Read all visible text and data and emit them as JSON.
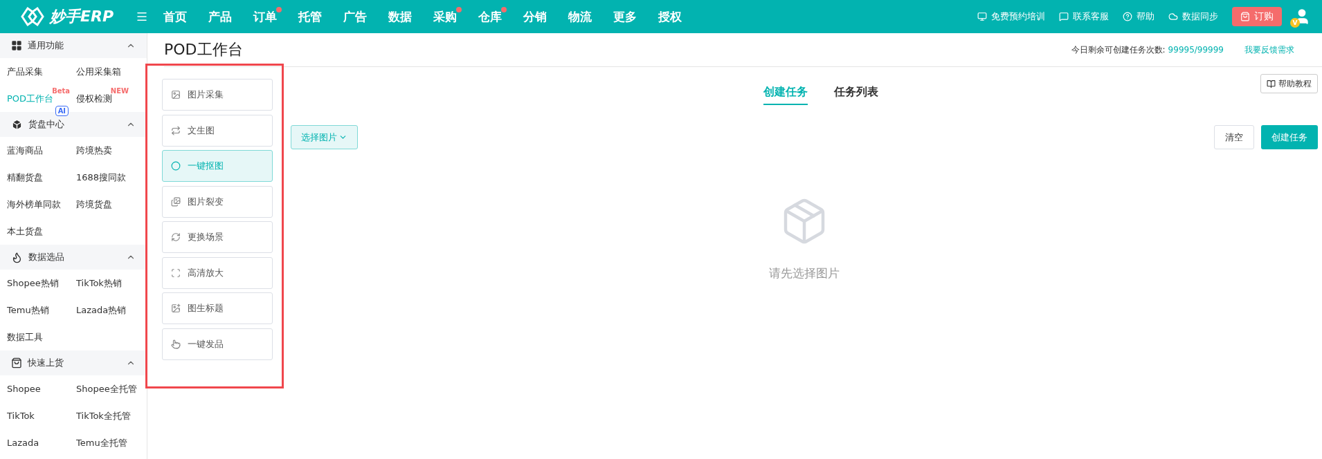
{
  "header": {
    "logo": "妙手ERP",
    "nav": [
      {
        "label": "首页",
        "dot": false
      },
      {
        "label": "产品",
        "dot": false
      },
      {
        "label": "订单",
        "dot": true
      },
      {
        "label": "托管",
        "dot": false
      },
      {
        "label": "广告",
        "dot": false
      },
      {
        "label": "数据",
        "dot": false
      },
      {
        "label": "采购",
        "dot": true
      },
      {
        "label": "仓库",
        "dot": true
      },
      {
        "label": "分销",
        "dot": false
      },
      {
        "label": "物流",
        "dot": false
      },
      {
        "label": "更多",
        "dot": false
      },
      {
        "label": "授权",
        "dot": false
      }
    ],
    "links": [
      {
        "kind": "training",
        "label": "免费预约培训"
      },
      {
        "kind": "service",
        "label": "联系客服"
      },
      {
        "kind": "help",
        "label": "帮助"
      },
      {
        "kind": "sync",
        "label": "数据同步"
      }
    ],
    "order_button": "订购",
    "avatar_badge": "V"
  },
  "sidebar": {
    "sections": [
      {
        "kind": "grid",
        "title": "通用功能",
        "expanded": true,
        "items": [
          {
            "label": "产品采集",
            "selected": false
          },
          {
            "label": "公用采集箱",
            "selected": false
          },
          {
            "label": "POD工作台",
            "selected": true,
            "badges": [
              {
                "kind": "sup",
                "text": "Beta"
              },
              {
                "kind": "tag",
                "text": "AI"
              }
            ]
          },
          {
            "label": "侵权检测",
            "selected": false,
            "badges": [
              {
                "kind": "sup",
                "text": "NEW"
              }
            ]
          }
        ]
      },
      {
        "kind": "box",
        "title": "货盘中心",
        "expanded": true,
        "items": [
          {
            "label": "蓝海商品",
            "selected": false
          },
          {
            "label": "跨境热卖",
            "selected": false
          },
          {
            "label": "精翻货盘",
            "selected": false
          },
          {
            "label": "1688搜同款",
            "selected": false
          },
          {
            "label": "海外榜单同款",
            "selected": false
          },
          {
            "label": "跨境货盘",
            "selected": false
          },
          {
            "label": "本土货盘",
            "selected": false
          }
        ]
      },
      {
        "kind": "flame",
        "title": "数据选品",
        "expanded": true,
        "items": [
          {
            "label": "Shopee热销",
            "selected": false
          },
          {
            "label": "TikTok热销",
            "selected": false
          },
          {
            "label": "Temu热销",
            "selected": false
          },
          {
            "label": "Lazada热销",
            "selected": false
          },
          {
            "label": "数据工具",
            "selected": false
          }
        ]
      },
      {
        "kind": "bag",
        "title": "快速上货",
        "expanded": true,
        "items": [
          {
            "label": "Shopee",
            "selected": false
          },
          {
            "label": "Shopee全托管",
            "selected": false
          },
          {
            "label": "TikTok",
            "selected": false
          },
          {
            "label": "TikTok全托管",
            "selected": false
          },
          {
            "label": "Lazada",
            "selected": false
          },
          {
            "label": "Temu全托管",
            "selected": false
          }
        ]
      }
    ]
  },
  "page": {
    "title": "POD工作台",
    "quota_label": "今日剩余可创建任务次数:",
    "quota_value": "99995/99999",
    "feedback_link": "我要反馈需求"
  },
  "tools": [
    {
      "kind": "image",
      "label": "图片采集",
      "selected": false
    },
    {
      "kind": "text",
      "label": "文生图",
      "selected": false
    },
    {
      "kind": "cutout",
      "label": "一键抠图",
      "selected": true
    },
    {
      "kind": "split",
      "label": "图片裂变",
      "selected": false
    },
    {
      "kind": "scene",
      "label": "更换场景",
      "selected": false
    },
    {
      "kind": "upscale",
      "label": "高清放大",
      "selected": false
    },
    {
      "kind": "title",
      "label": "图生标题",
      "selected": false
    },
    {
      "kind": "publish",
      "label": "一键发品",
      "selected": false
    }
  ],
  "tabs": [
    {
      "label": "创建任务",
      "selected": true
    },
    {
      "label": "任务列表",
      "selected": false
    }
  ],
  "help_button": "帮助教程",
  "select_button": "选择图片",
  "clear_button": "清空",
  "create_button": "创建任务",
  "empty_text": "请先选择图片"
}
